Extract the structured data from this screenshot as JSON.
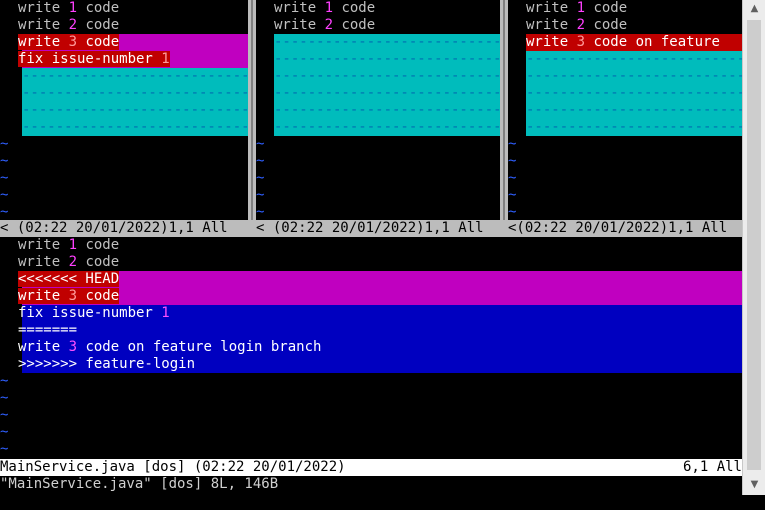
{
  "panes": {
    "left": {
      "lines": [
        {
          "t": "write ",
          "n": "1",
          "r": " code"
        },
        {
          "t": "write ",
          "n": "2",
          "r": " code"
        },
        {
          "t": "write ",
          "n": "3",
          "r": " code"
        },
        {
          "t": "fix issue-number ",
          "n": "1",
          "r": ""
        }
      ],
      "status": "< (02:22 20/01/2022)1,1 All"
    },
    "middle": {
      "lines": [
        {
          "t": "write ",
          "n": "1",
          "r": " code"
        },
        {
          "t": "write ",
          "n": "2",
          "r": " code"
        }
      ],
      "status": "< (02:22 20/01/2022)1,1 All"
    },
    "right": {
      "lines": [
        {
          "t": "write ",
          "n": "1",
          "r": " code"
        },
        {
          "t": "write ",
          "n": "2",
          "r": " code"
        },
        {
          "t": "write ",
          "n": "3",
          "r": " code on feature"
        }
      ],
      "status": "<(02:22 20/01/2022)1,1 All"
    }
  },
  "merged": {
    "lines": [
      {
        "t": "write ",
        "n": "1",
        "r": " code"
      },
      {
        "t": "write ",
        "n": "2",
        "r": " code"
      },
      {
        "t": "<<<<<<< HEAD",
        "n": "",
        "r": ""
      },
      {
        "t": "write ",
        "n": "3",
        "r": " code"
      },
      {
        "t": "fix issue-number ",
        "n": "1",
        "r": ""
      },
      {
        "t": "=======",
        "n": "",
        "r": ""
      },
      {
        "t": "write ",
        "n": "3",
        "r": " code on feature login branch"
      },
      {
        "t": ">>>>>>> feature-login",
        "n": "",
        "r": ""
      }
    ],
    "status_left": "MainService.java [dos] (02:22 20/01/2022)",
    "status_right": "6,1 All"
  },
  "cmdline": "\"MainService.java\" [dos] 8L, 146B",
  "filler": "----------------------------------------------------------------------------",
  "tilde": "~",
  "colors": {
    "magenta": "#c000c0",
    "cyan": "#00bcbc",
    "red": "#c00000",
    "blue": "#0000c0",
    "tilde": "#2f5fff",
    "number": "#ff40ff"
  }
}
